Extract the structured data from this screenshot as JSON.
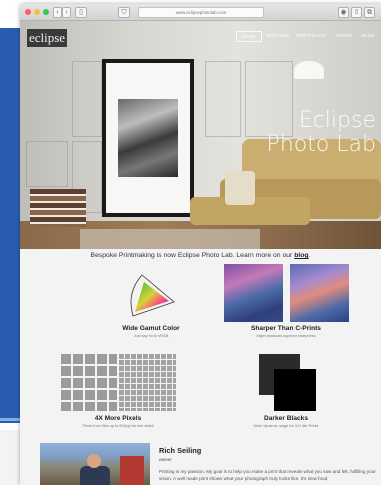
{
  "browser": {
    "url": "www.eclipsephotolab.com"
  },
  "site": {
    "logo": "eclipse",
    "nav": [
      "HOME",
      "SERVICES",
      "PORTFOLIOS",
      "ORDER",
      "BLOG"
    ],
    "hero_title_line1": "Eclipse",
    "hero_title_line2": "Photo Lab"
  },
  "announcement": {
    "text": "Bespoke Printmaking is now Eclipse Photo Lab.  Learn more on our ",
    "link": "blog",
    "suffix": "."
  },
  "features": [
    {
      "title": "Wide Gamut Color",
      "subtitle": "Just say no to sRGB"
    },
    {
      "title": "Sharper Than C-Prints",
      "subtitle": "Inkjet produces superior sharpness"
    },
    {
      "title": "4X More Pixels",
      "subtitle": "Prints from files up to 600ppi for fine detail"
    },
    {
      "title": "Darker Blacks",
      "subtitle": "More dynamic range for 3-D like Prints"
    }
  ],
  "bio": {
    "name": "Rich Seiling",
    "role": "owner",
    "text": "Printing is my passion. My goal is to help you make a print that reveals what you saw and felt, fulfilling your vision. A well made print shows what your photograph truly looks like. It's slow food,"
  },
  "colors": {
    "page_bg": "#f3f3f3",
    "desktop_window": "#2a5db0",
    "sofa": "#c9ae6f"
  }
}
